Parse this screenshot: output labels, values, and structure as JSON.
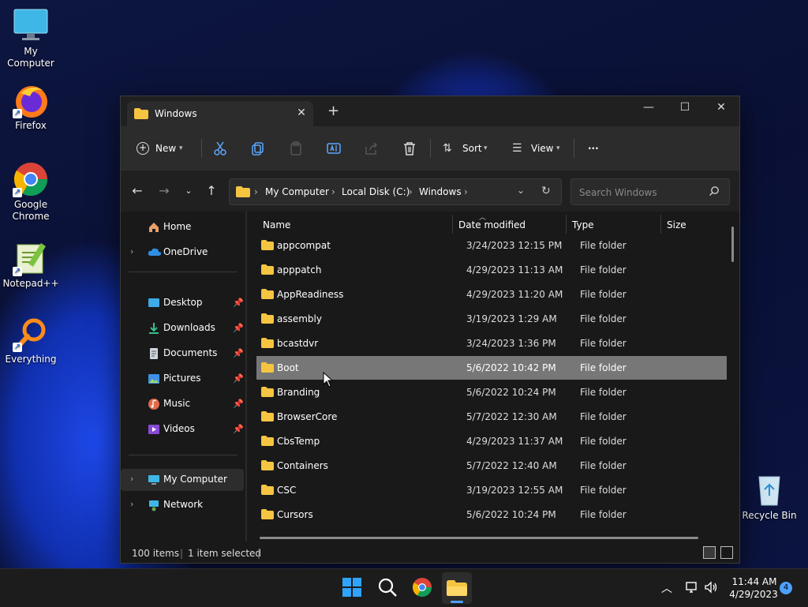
{
  "desktop": {
    "icons": [
      {
        "label": "My Computer"
      },
      {
        "label": "Firefox"
      },
      {
        "label": "Google Chrome"
      },
      {
        "label": "Notepad++"
      },
      {
        "label": "Everything"
      },
      {
        "label": "Recycle Bin"
      }
    ]
  },
  "explorer": {
    "tab_title": "Windows",
    "tab_close": "✕",
    "new_tab": "+",
    "controls": {
      "minimize": "—",
      "maximize": "☐",
      "close": "✕"
    },
    "toolbar": {
      "new_label": "New",
      "sort_label": "Sort",
      "view_label": "View",
      "more_label": "···"
    },
    "address": {
      "breadcrumbs": [
        "My Computer",
        "Local Disk (C:)",
        "Windows"
      ],
      "search_placeholder": "Search Windows"
    },
    "nav": {
      "home": "Home",
      "onedrive": "OneDrive",
      "quick_access": [
        {
          "label": "Desktop"
        },
        {
          "label": "Downloads"
        },
        {
          "label": "Documents"
        },
        {
          "label": "Pictures"
        },
        {
          "label": "Music"
        },
        {
          "label": "Videos"
        }
      ],
      "my_computer": "My Computer",
      "network": "Network"
    },
    "columns": {
      "name": "Name",
      "date": "Date modified",
      "type": "Type",
      "size": "Size"
    },
    "rows": [
      {
        "name": "appcompat",
        "date": "3/24/2023 12:15 PM",
        "type": "File folder"
      },
      {
        "name": "apppatch",
        "date": "4/29/2023 11:13 AM",
        "type": "File folder"
      },
      {
        "name": "AppReadiness",
        "date": "4/29/2023 11:20 AM",
        "type": "File folder"
      },
      {
        "name": "assembly",
        "date": "3/19/2023 1:29 AM",
        "type": "File folder"
      },
      {
        "name": "bcastdvr",
        "date": "3/24/2023 1:36 PM",
        "type": "File folder"
      },
      {
        "name": "Boot",
        "date": "5/6/2022 10:42 PM",
        "type": "File folder"
      },
      {
        "name": "Branding",
        "date": "5/6/2022 10:24 PM",
        "type": "File folder"
      },
      {
        "name": "BrowserCore",
        "date": "5/7/2022 12:30 AM",
        "type": "File folder"
      },
      {
        "name": "CbsTemp",
        "date": "4/29/2023 11:37 AM",
        "type": "File folder"
      },
      {
        "name": "Containers",
        "date": "5/7/2022 12:40 AM",
        "type": "File folder"
      },
      {
        "name": "CSC",
        "date": "3/19/2023 12:55 AM",
        "type": "File folder"
      },
      {
        "name": "Cursors",
        "date": "5/6/2022 10:24 PM",
        "type": "File folder"
      }
    ],
    "status": {
      "items": "100 items",
      "selected": "1 item selected"
    }
  },
  "taskbar": {
    "time": "11:44 AM",
    "date": "4/29/2023",
    "notification_count": "4"
  },
  "colors": {
    "folder": "#f5c542",
    "selected_row": "#777777",
    "accent": "#4ca0ff"
  }
}
